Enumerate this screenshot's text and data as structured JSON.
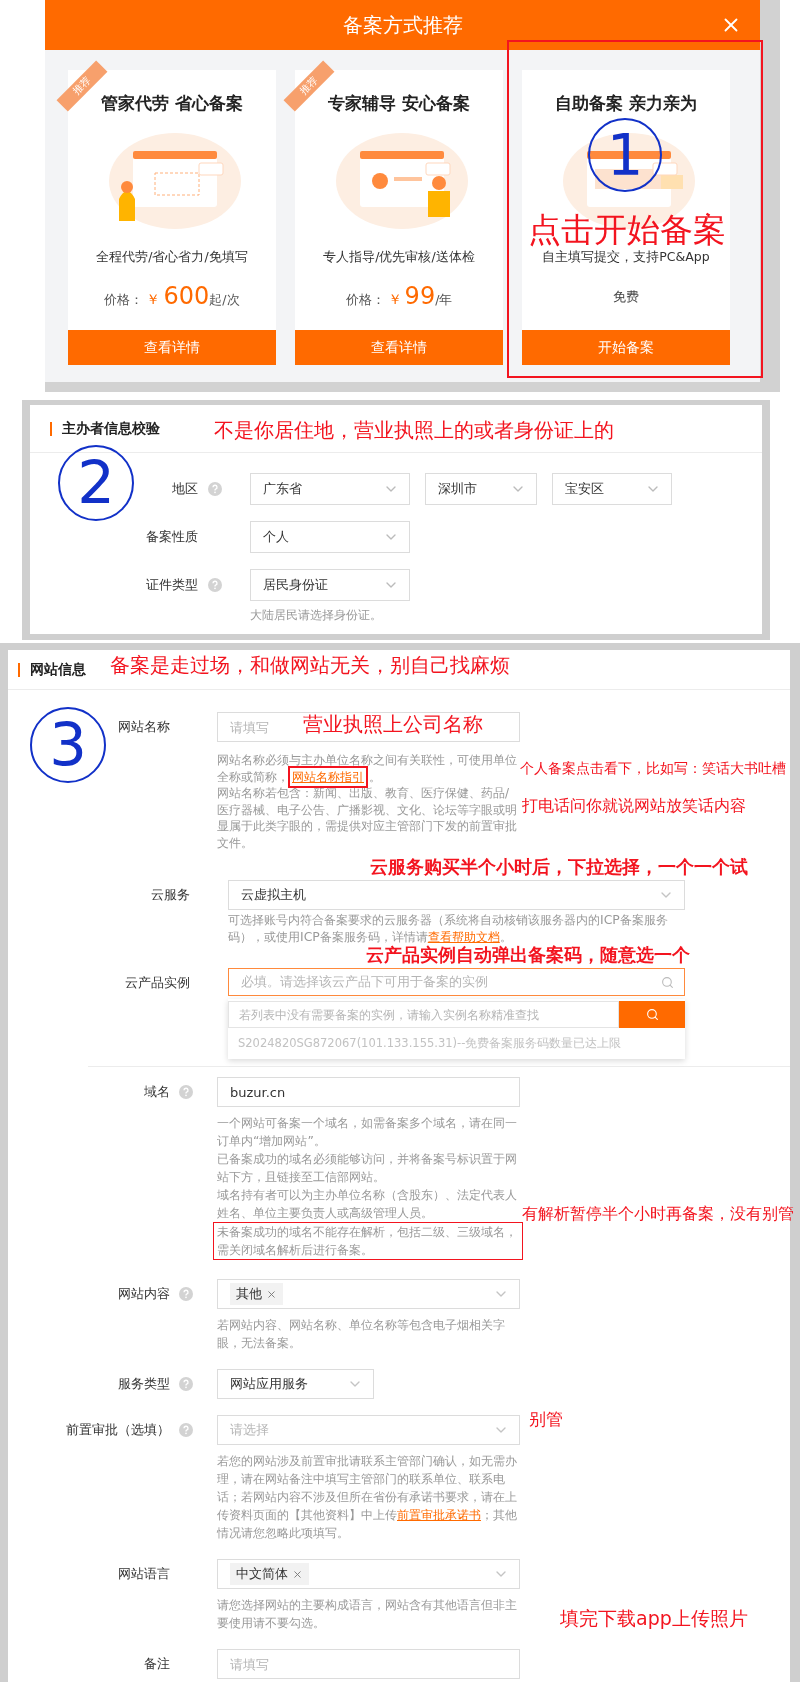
{
  "dialog": {
    "title": "备案方式推荐",
    "cards": [
      {
        "badge": "推荐",
        "title": "管家代劳 省心备案",
        "desc": "全程代劳/省心省力/免填写",
        "price": {
          "label": "价格：",
          "currency": "￥",
          "amount": "600",
          "unit": "起/次"
        },
        "button": "查看详情"
      },
      {
        "badge": "推荐",
        "title": "专家辅导 安心备案",
        "desc": "专人指导/优先审核/送体检",
        "price": {
          "label": "价格：",
          "currency": "￥",
          "amount": "99",
          "unit": "/年"
        },
        "button": "查看详情"
      },
      {
        "title": "自助备案 亲力亲为",
        "desc": "自主填写提交，支持PC&App",
        "free": "免费",
        "button": "开始备案",
        "highlighted": true,
        "step": "1",
        "note": "点击开始备案"
      }
    ]
  },
  "owner_check": {
    "title": "主办者信息校验",
    "note": "不是你居住地，营业执照上的或者身份证上的",
    "step": "2",
    "rows": [
      {
        "label": "地区",
        "help": true,
        "selects": [
          "广东省",
          "深圳市",
          "宝安区"
        ]
      },
      {
        "label": "备案性质",
        "help": false,
        "selects": [
          "个人"
        ]
      },
      {
        "label": "证件类型",
        "help": true,
        "selects": [
          "居民身份证"
        ],
        "hint": "大陆居民请选择身份证。"
      }
    ]
  },
  "site_info": {
    "title": "网站信息",
    "step": "3",
    "groups": [
      {
        "fields": [
          {
            "label": "网站名称",
            "help": false,
            "kind": "input",
            "placeholder": "请填写",
            "hints": [
              {
                "parts": [
                  {
                    "text": "网站名称必须与主办单位名称之间有关联性，可使用单位全称或简称，"
                  },
                  {
                    "text": "网站名称指引",
                    "link": true,
                    "boxed": true
                  },
                  {
                    "text": "。"
                  }
                ]
              },
              {
                "parts": [
                  {
                    "text": "网站名称若包含：新闻、出版、教育、医疗保健、药品/医疗器械、电子公告、广播影视、文化、论坛等字眼或明显属于此类字眼的，需提供对应主管部门下发的前置审批文件。"
                  }
                ]
              }
            ]
          }
        ]
      },
      {
        "fields": [
          {
            "label": "云服务",
            "help": false,
            "kind": "select",
            "value": "云虚拟主机",
            "hints": [
              {
                "parts": [
                  {
                    "text": "可选择账号内符合备案要求的云服务器（系统将自动核销该服务器内的ICP备案服务码），或使用ICP备案服务码，详情请"
                  },
                  {
                    "text": "查看帮助文档",
                    "link": true
                  },
                  {
                    "text": "。"
                  }
                ]
              }
            ]
          },
          {
            "label": "云产品实例",
            "help": false,
            "kind": "search-select",
            "focused": true,
            "placeholder": "必填。请选择该云产品下可用于备案的实例",
            "dropdown": {
              "search_placeholder": "若列表中没有需要备案的实例，请输入实例名称精准查找",
              "options": [
                {
                  "text": "S2024820SG872067(101.133.155.31)--免费备案服务码数量已达上限",
                  "disabled": true
                }
              ]
            }
          }
        ]
      },
      {
        "fields": [
          {
            "label": "域名",
            "help": true,
            "kind": "input",
            "value": "buzur.cn",
            "hints": [
              {
                "parts": [
                  {
                    "text": "一个网站可备案一个域名，如需备案多个域名，请在同一订单内“增加网站”。"
                  }
                ]
              },
              {
                "parts": [
                  {
                    "text": "已备案成功的域名必须能够访问，并将备案号标识置于网站下方，且链接至工信部网站。"
                  }
                ]
              },
              {
                "parts": [
                  {
                    "text": "域名持有者可以为主办单位名称（含股东）、法定代表人姓名、单位主要负责人或高级管理人员。"
                  }
                ]
              },
              {
                "boxed": true,
                "parts": [
                  {
                    "text": "未备案成功的域名不能存在解析，包括二级、三级域名，需关闭域名解析后进行备案。"
                  }
                ]
              }
            ]
          },
          {
            "label": "网站内容",
            "help": true,
            "kind": "tags",
            "tags": [
              "其他"
            ],
            "hints": [
              {
                "parts": [
                  {
                    "text": "若网站内容、网站名称、单位名称等包含电子烟相关字眼，无法备案。"
                  }
                ]
              }
            ]
          },
          {
            "label": "服务类型",
            "help": true,
            "kind": "compact-select",
            "value": "网站应用服务"
          },
          {
            "label": "前置审批（选填）",
            "help": true,
            "kind": "select",
            "placeholder": "请选择",
            "hints": [
              {
                "parts": [
                  {
                    "text": "若您的网站涉及前置审批请联系主管部门确认，如无需办理，请在网站备注中填写主管部门的联系单位、联系电话；若网站内容不涉及但所在省份有承诺书要求，请在上传资料页面的【其他资料】中上传"
                  },
                  {
                    "text": "前置审批承诺书",
                    "link": true
                  },
                  {
                    "text": "；其他情况请您忽略此项填写。"
                  }
                ]
              }
            ]
          },
          {
            "label": "网站语言",
            "help": false,
            "kind": "tags",
            "tags": [
              "中文简体"
            ],
            "hints": [
              {
                "parts": [
                  {
                    "text": "请您选择网站的主要构成语言，网站含有其他语言但非主要使用请不要勾选。"
                  }
                ]
              }
            ]
          },
          {
            "label": "备注",
            "help": false,
            "kind": "input",
            "placeholder": "请填写"
          }
        ]
      }
    ],
    "annotations": [
      {
        "kind": "note",
        "text": "备案是走过场，和做网站无关，别自己找麻烦"
      },
      {
        "kind": "note",
        "text": "营业执照上公司名称"
      },
      {
        "kind": "note",
        "text": "个人备案点击看下，比如写：笑话大书吐槽"
      },
      {
        "kind": "note",
        "text": "打电话问你就说网站放笑话内容"
      },
      {
        "kind": "bold-note",
        "text": "云服务购买半个小时后，下拉选择，一个一个试"
      },
      {
        "kind": "bold-note",
        "text": "云产品实例自动弹出备案码，随意选一个"
      },
      {
        "kind": "note",
        "text": "有解析暂停半个小时再备案，没有别管"
      },
      {
        "kind": "note",
        "text": "别管"
      },
      {
        "kind": "note",
        "text": "填完下载app上传照片"
      }
    ]
  }
}
